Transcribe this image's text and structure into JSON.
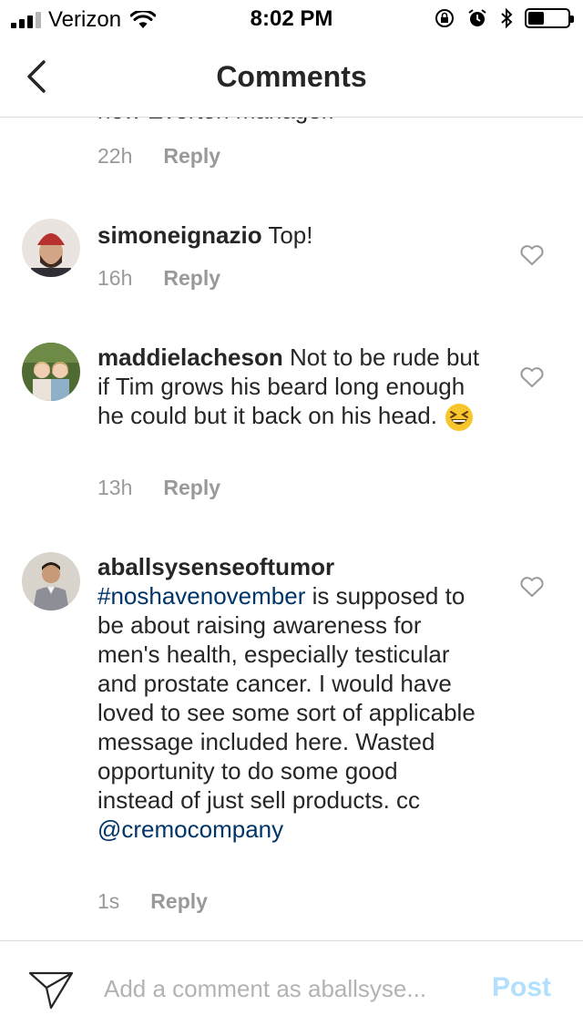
{
  "status_bar": {
    "carrier": "Verizon",
    "time": "8:02 PM",
    "signal_bars_filled": 3,
    "signal_bars_total": 4,
    "battery_level": 0.4
  },
  "header": {
    "title": "Comments",
    "back_icon": "chevron-left-icon"
  },
  "comments": [
    {
      "text_partial": "new Everton manager.",
      "time": "22h",
      "reply_label": "Reply"
    },
    {
      "username": "simoneignazio",
      "text": "Top!",
      "time": "16h",
      "reply_label": "Reply"
    },
    {
      "username": "maddielacheson",
      "text": "Not to be rude but if Tim grows his beard long enough he could but it back on his head.",
      "emoji": "grinning-squinting-face",
      "time": "13h",
      "reply_label": "Reply"
    },
    {
      "username": "aballsysenseoftumor",
      "hashtag": "#noshavenovember",
      "text": "is supposed to be about raising awareness for men's health, especially testicular and prostate cancer. I would have loved to see some sort of applicable message included here. Wasted opportunity to do some good instead of just sell products. cc",
      "mention": "@cremocompany",
      "time": "1s",
      "reply_label": "Reply"
    }
  ],
  "compose": {
    "placeholder": "Add a comment as aballsyse...",
    "value": "",
    "post_label": "Post",
    "send_icon": "paper-plane-icon"
  },
  "colors": {
    "text": "#262626",
    "meta": "#999999",
    "link": "#003569",
    "post_disabled": "#b2dffc",
    "divider": "#dbdbdb"
  }
}
